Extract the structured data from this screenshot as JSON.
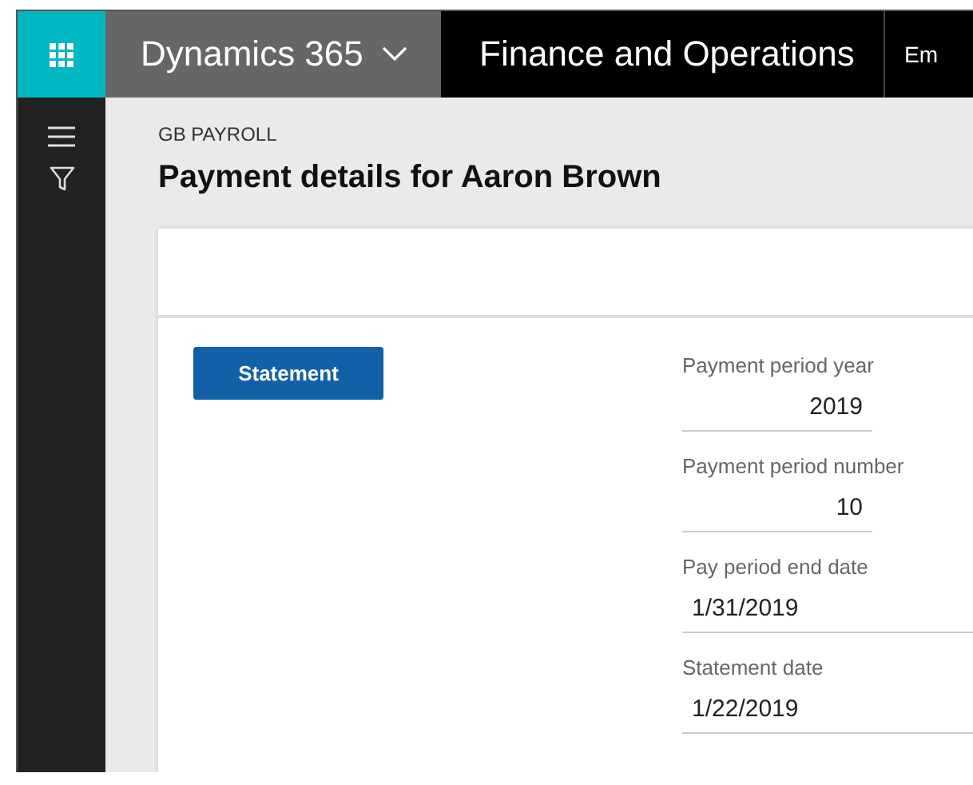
{
  "top_bar": {
    "app_menu": "Dynamics 365",
    "module": "Finance and Operations",
    "company": "Em"
  },
  "page": {
    "breadcrumb": "GB PAYROLL",
    "title": "Payment details for Aaron Brown"
  },
  "actions": [
    "Statement"
  ],
  "fields": [
    {
      "kind": "number",
      "label": "Payment period year",
      "value": "2019"
    },
    {
      "kind": "number",
      "label": "Payment period number",
      "value": "10"
    },
    {
      "kind": "date",
      "label": "Pay period end date",
      "value": "1/31/2019"
    },
    {
      "kind": "date",
      "label": "Statement date",
      "value": "1/22/2019"
    }
  ]
}
